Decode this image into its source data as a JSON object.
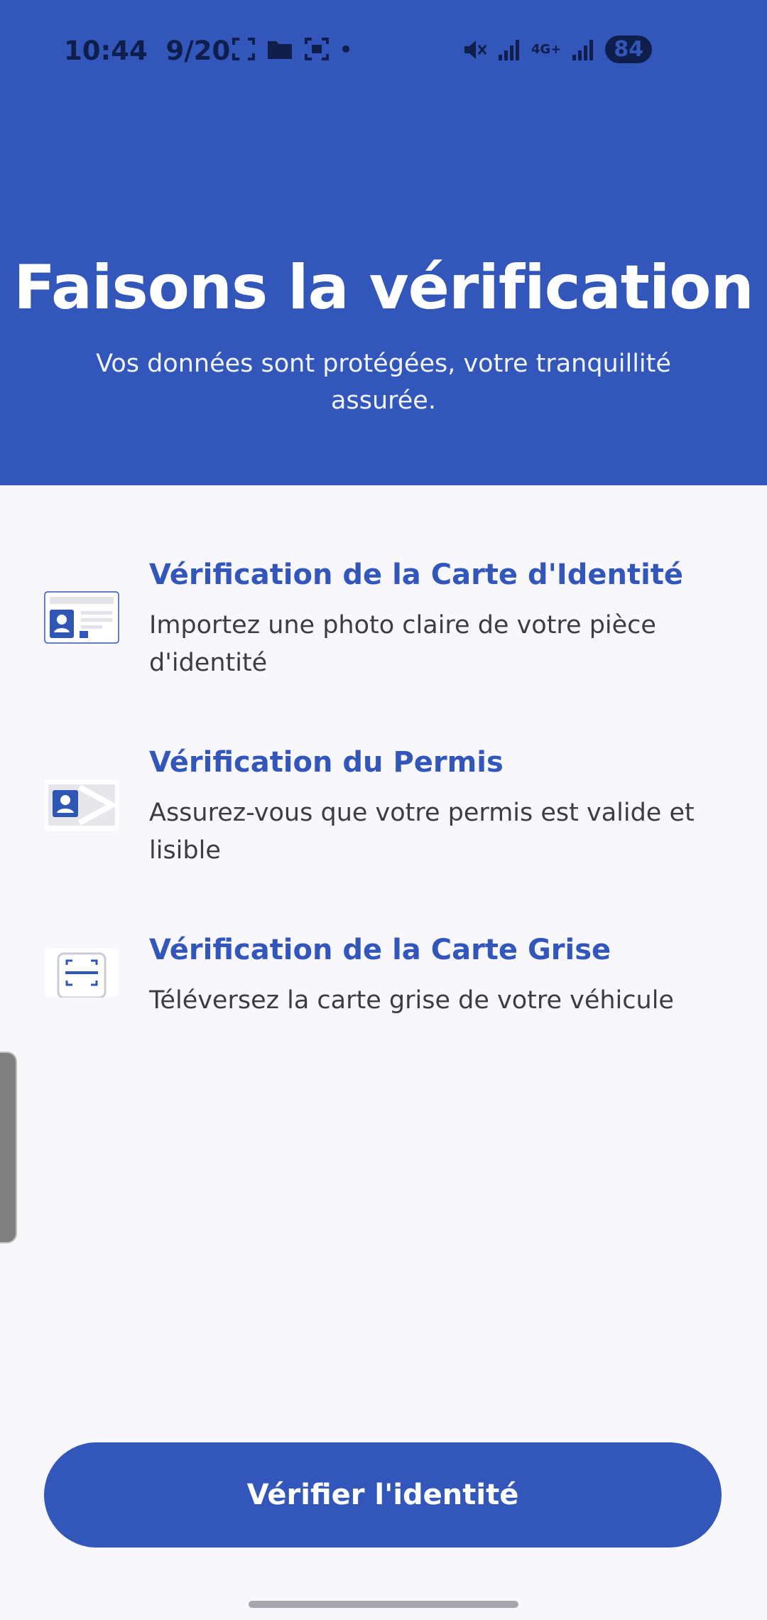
{
  "status_bar": {
    "time": "10:44",
    "date": "9/20",
    "battery": "84",
    "network": "4G+"
  },
  "header": {
    "title": "Faisons la vérification",
    "subtitle": "Vos données sont protégées, votre tranquillité assurée."
  },
  "items": [
    {
      "title": "Vérification de la Carte d'Identité",
      "description": "Importez une photo claire de votre pièce d'identité",
      "icon": "id-card-icon"
    },
    {
      "title": "Vérification du Permis",
      "description": "Assurez-vous que votre permis est valide et lisible",
      "icon": "license-icon"
    },
    {
      "title": "Vérification de la Carte Grise",
      "description": "Téléversez la carte grise de votre véhicule",
      "icon": "registration-card-icon"
    }
  ],
  "cta": {
    "label": "Vérifier l'identité"
  },
  "colors": {
    "primary": "#3256B9",
    "background": "#F8F8FC",
    "text": "#3C3C45"
  }
}
